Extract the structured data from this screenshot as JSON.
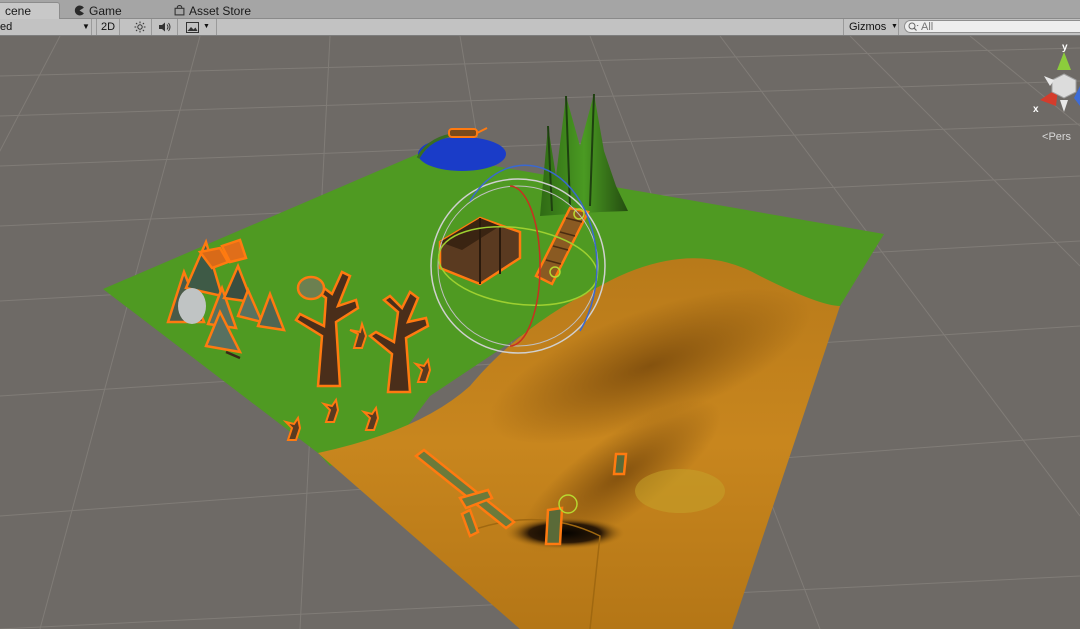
{
  "tabs": [
    {
      "id": "scene",
      "label": "cene",
      "active": true,
      "icon": "scene-icon"
    },
    {
      "id": "game",
      "label": "Game",
      "active": false,
      "icon": "game-pacman-icon"
    },
    {
      "id": "store",
      "label": "Asset Store",
      "active": false,
      "icon": "asset-store-bag-icon"
    }
  ],
  "toolbar": {
    "draw_mode": "ed",
    "mode_2d": "2D",
    "lighting_icon": "sun-icon",
    "audio_icon": "speaker-icon",
    "effects_icon": "image-effects-icon",
    "gizmos_label": "Gizmos",
    "search_placeholder": "All"
  },
  "orientation_gizmo": {
    "y_label": "y",
    "x_label": "x",
    "projection_label": "Pers",
    "colors": {
      "y": "#8ccc3c",
      "x": "#d43c2c",
      "z": "#3c6cd8"
    }
  },
  "scene_colors": {
    "background": "#6e6a66",
    "grid": "#7c7873",
    "grass": "#4f9a22",
    "sand": "#c8861e",
    "water": "#1a3cc8",
    "selection_outline": "#ff7a10"
  }
}
